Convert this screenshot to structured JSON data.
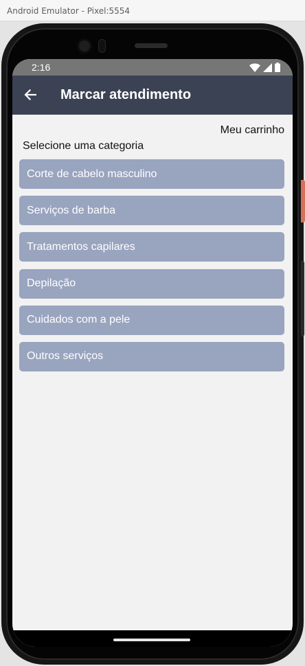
{
  "window": {
    "title": "Android Emulator - Pixel:5554"
  },
  "status_bar": {
    "time": "2:16",
    "icons": [
      "wifi-icon",
      "cell-signal-icon",
      "battery-icon"
    ]
  },
  "app_bar": {
    "back_icon": "arrow-left-icon",
    "title": "Marcar atendimento",
    "background_color": "#3b4253"
  },
  "content": {
    "cart_link": "Meu carrinho",
    "section_label": "Selecione uma categoria",
    "category_color": "#99a4bf",
    "categories": [
      "Corte de cabelo masculino",
      "Serviços de barba",
      "Tratamentos capilares",
      "Depilação",
      "Cuidados com a pele",
      "Outros serviços"
    ]
  }
}
